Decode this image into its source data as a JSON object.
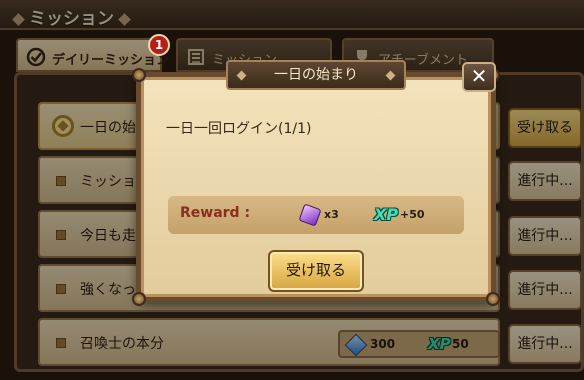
{
  "header": {
    "title": "ミッション"
  },
  "tabs": [
    {
      "label": "デイリーミッション",
      "badge": "1",
      "icon": "check-circle-icon"
    },
    {
      "label": "ミッション",
      "icon": "list-icon"
    },
    {
      "label": "アチーブメント",
      "icon": "trophy-icon"
    }
  ],
  "missions": [
    {
      "label": "一日の始まり",
      "button": "受け取る"
    },
    {
      "label": "ミッション",
      "button": "進行中..."
    },
    {
      "label": "今日も走",
      "button": "進行中..."
    },
    {
      "label": "強くなっ",
      "button": "進行中..."
    },
    {
      "label": "召喚士の本分",
      "button": "進行中...",
      "reward_crystals": "300",
      "reward_xp_label": "XP",
      "reward_xp": "50"
    }
  ],
  "popup": {
    "title": "一日の始まり",
    "close_label": "✕",
    "description": "一日一回ログイン(1/1)",
    "reward_label": "Reward :",
    "reward_item_qty": "x3",
    "reward_xp_label": "XP",
    "reward_xp": "+50",
    "receive_button": "受け取る"
  },
  "colors": {
    "accent_gold": "#d6a440",
    "panel_parchment": "#f0dfb8",
    "frame_brown": "#6a4a2c",
    "reward_label_red": "#8a2f1f",
    "xp_teal": "#3fe0b8"
  }
}
